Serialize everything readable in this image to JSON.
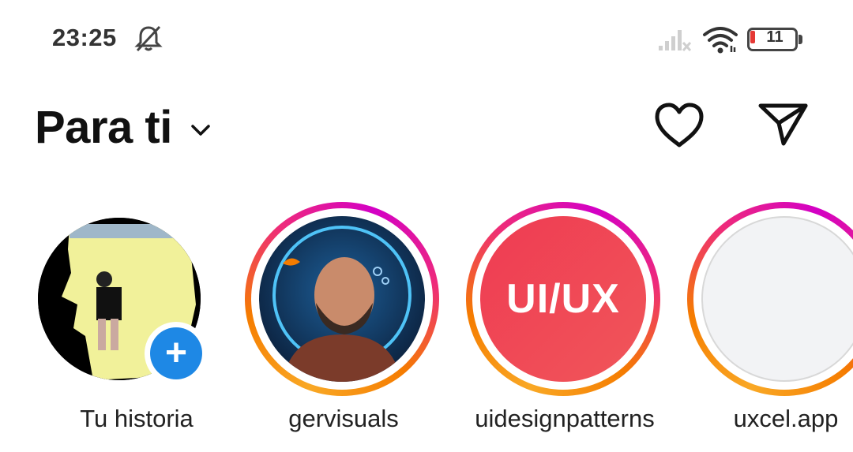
{
  "status_bar": {
    "time": "23:25",
    "battery_level": "11",
    "icons": [
      "bell-muted-icon",
      "signal-icon",
      "wifi-icon",
      "battery-icon"
    ]
  },
  "header": {
    "title": "Para ti",
    "icons": [
      "chevron-down-icon",
      "heart-icon",
      "send-icon"
    ]
  },
  "stories": [
    {
      "label": "Tu historia",
      "own": true
    },
    {
      "label": "gervisuals"
    },
    {
      "label": "uidesignpatterns",
      "avatar_text": "UI/UX"
    },
    {
      "label": "uxcel.app"
    }
  ],
  "colors": {
    "add_badge": "#1e88e5",
    "uiux_brand": "#ef3b52",
    "battery_low": "#e53935"
  }
}
